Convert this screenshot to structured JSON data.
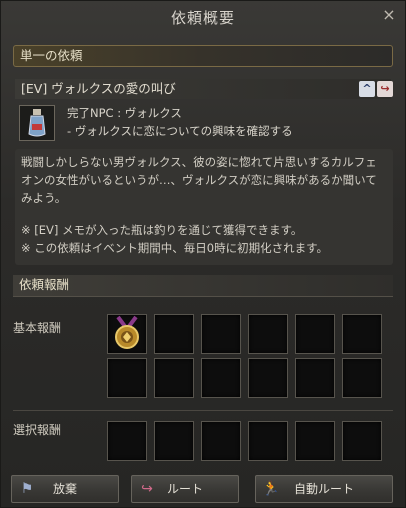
{
  "window": {
    "title": "依頼概要",
    "close_icon": "×"
  },
  "quest_type": "単一の依頼",
  "quest": {
    "title": "[EV] ヴォルクスの愛の叫び",
    "icons": [
      "navigate-icon",
      "route-icon"
    ],
    "npc_line": "完了NPC : ヴォルクス",
    "objective": "- ヴォルクスに恋についての興味を確認する",
    "description": [
      "戦闘しかしらない男ヴォルクス、彼の姿に惚れて片思いするカルフェオンの女性がいるというが…、ヴォルクスが恋に興味があるか聞いてみよう。",
      "",
      "※ [EV] メモが入った瓶は釣りを通じて獲得できます。",
      "※ この依頼はイベント期間中、毎日0時に初期化されます。"
    ]
  },
  "rewards": {
    "header": "依頼報酬",
    "basic_label": "基本報酬",
    "choice_label": "選択報酬",
    "basic_slots": 12,
    "choice_slots": 6,
    "basic_items": [
      "medal-icon"
    ]
  },
  "buttons": {
    "abandon": "放棄",
    "route": "ルート",
    "auto_route": "自動ルート"
  }
}
